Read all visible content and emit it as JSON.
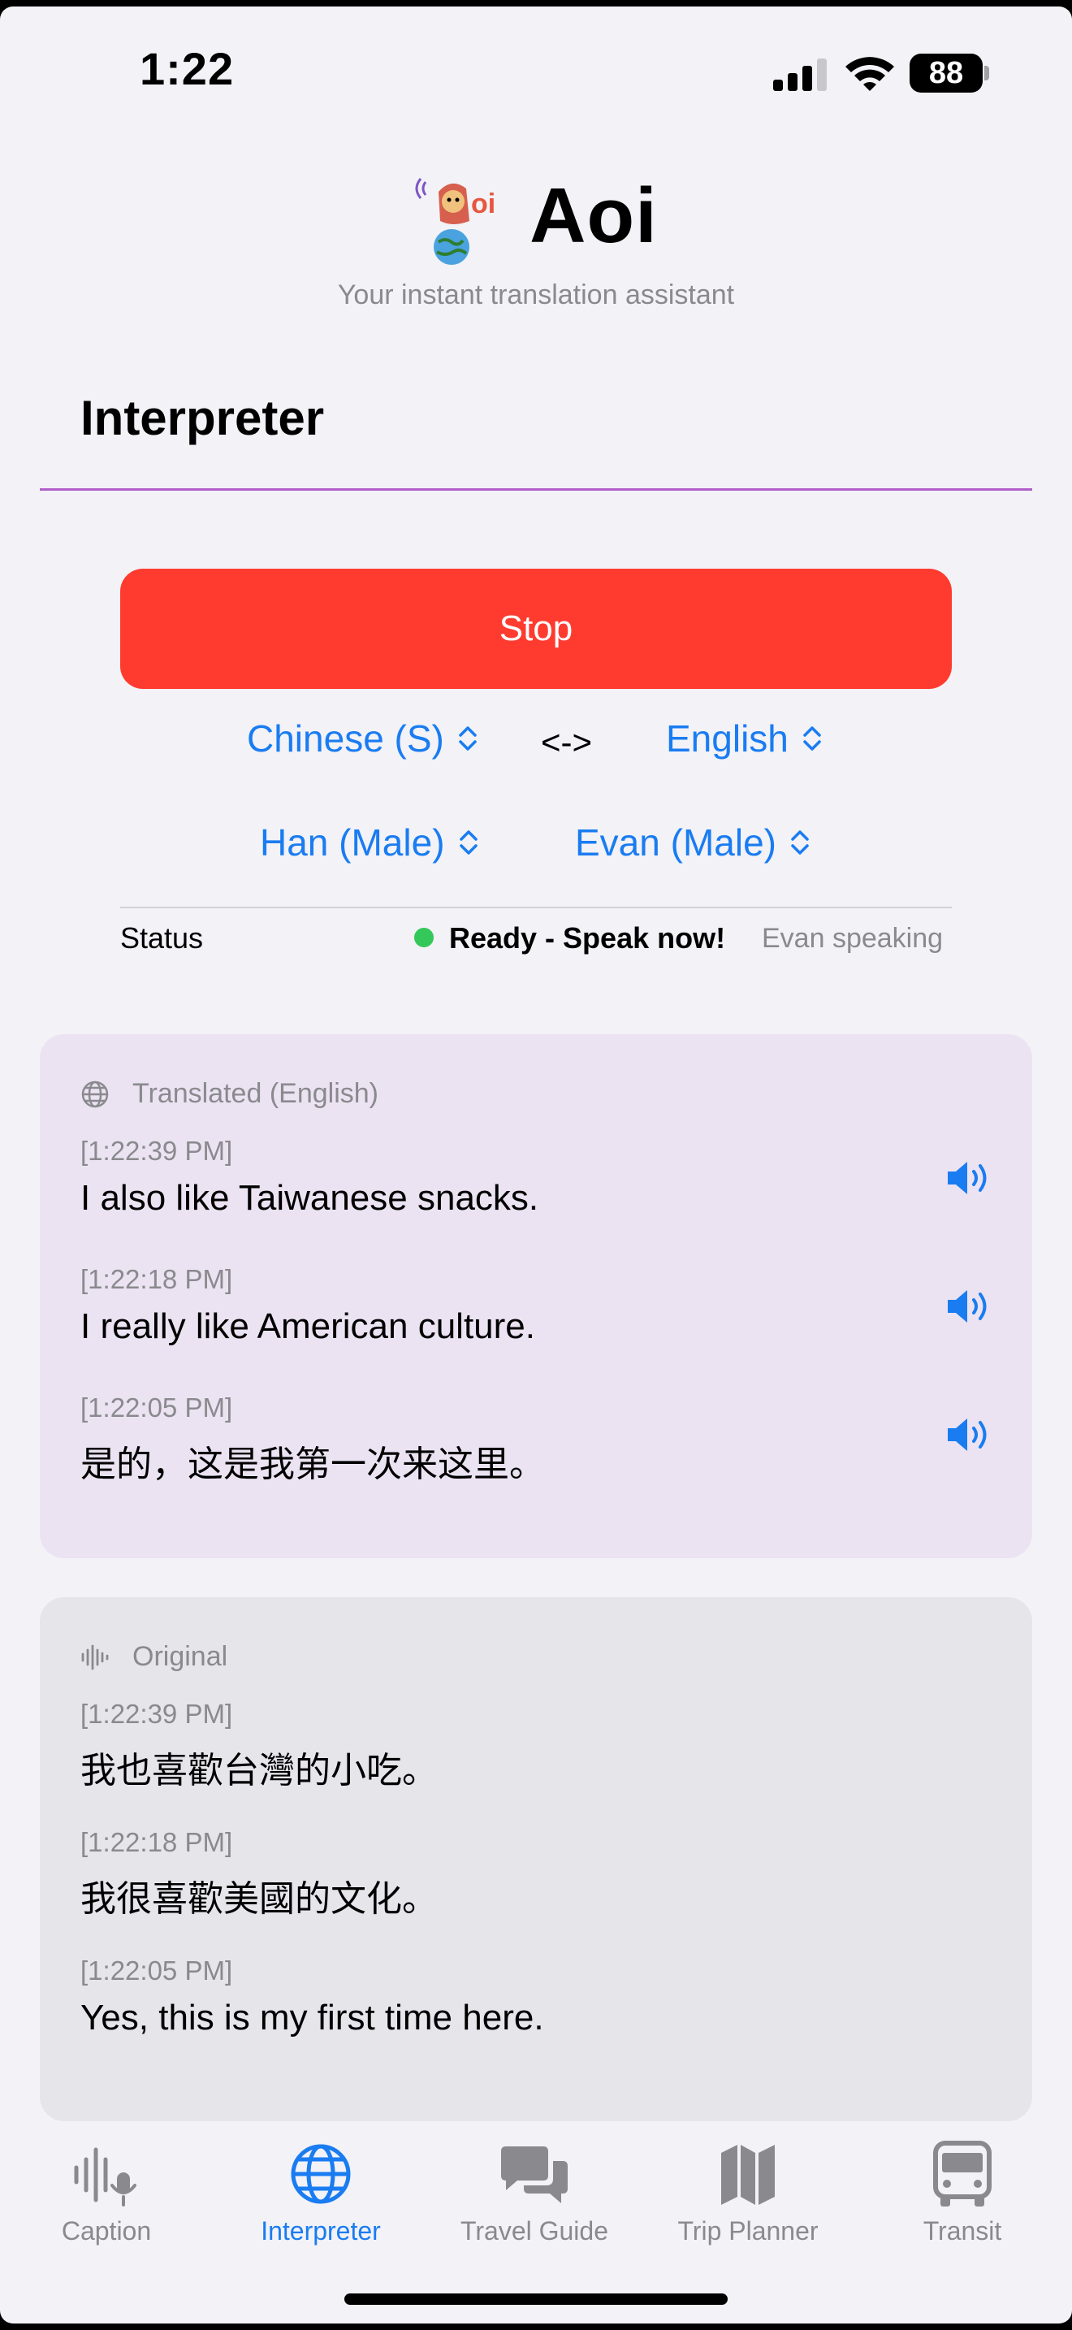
{
  "status_bar": {
    "time": "1:22",
    "battery": "88"
  },
  "header": {
    "app_name": "Aoi",
    "tagline": "Your instant translation assistant"
  },
  "section": {
    "title": "Interpreter"
  },
  "controls": {
    "stop_label": "Stop",
    "source_language": "Chinese (S)",
    "swap_label": "<->",
    "target_language": "English",
    "source_voice": "Han (Male)",
    "target_voice": "Evan (Male)"
  },
  "status": {
    "label": "Status",
    "value": "Ready - Speak now!",
    "speaker": "Evan speaking",
    "indicator_color": "#34c759"
  },
  "translated": {
    "title": "Translated (English)",
    "entries": [
      {
        "time": "[1:22:39 PM]",
        "text": "I also like Taiwanese snacks."
      },
      {
        "time": "[1:22:18 PM]",
        "text": "I really like American culture."
      },
      {
        "time": "[1:22:05 PM]",
        "text": "是的，这是我第一次来这里。"
      }
    ]
  },
  "original": {
    "title": "Original",
    "entries": [
      {
        "time": "[1:22:39 PM]",
        "text": "我也喜歡台灣的小吃。"
      },
      {
        "time": "[1:22:18 PM]",
        "text": "我很喜歡美國的文化。"
      },
      {
        "time": "[1:22:05 PM]",
        "text": "Yes, this is my first time here."
      }
    ]
  },
  "tabs": [
    {
      "label": "Caption",
      "icon": "waveform-mic-icon",
      "active": false
    },
    {
      "label": "Interpreter",
      "icon": "globe-icon",
      "active": true
    },
    {
      "label": "Travel Guide",
      "icon": "chat-bubbles-icon",
      "active": false
    },
    {
      "label": "Trip Planner",
      "icon": "map-icon",
      "active": false
    },
    {
      "label": "Transit",
      "icon": "bus-icon",
      "active": false
    }
  ],
  "colors": {
    "accent": "#1a7cf1",
    "stop": "#ff3b30",
    "divider": "#b15fc9",
    "translated_bg": "#ebe3f2",
    "original_bg": "#e5e5ea"
  }
}
